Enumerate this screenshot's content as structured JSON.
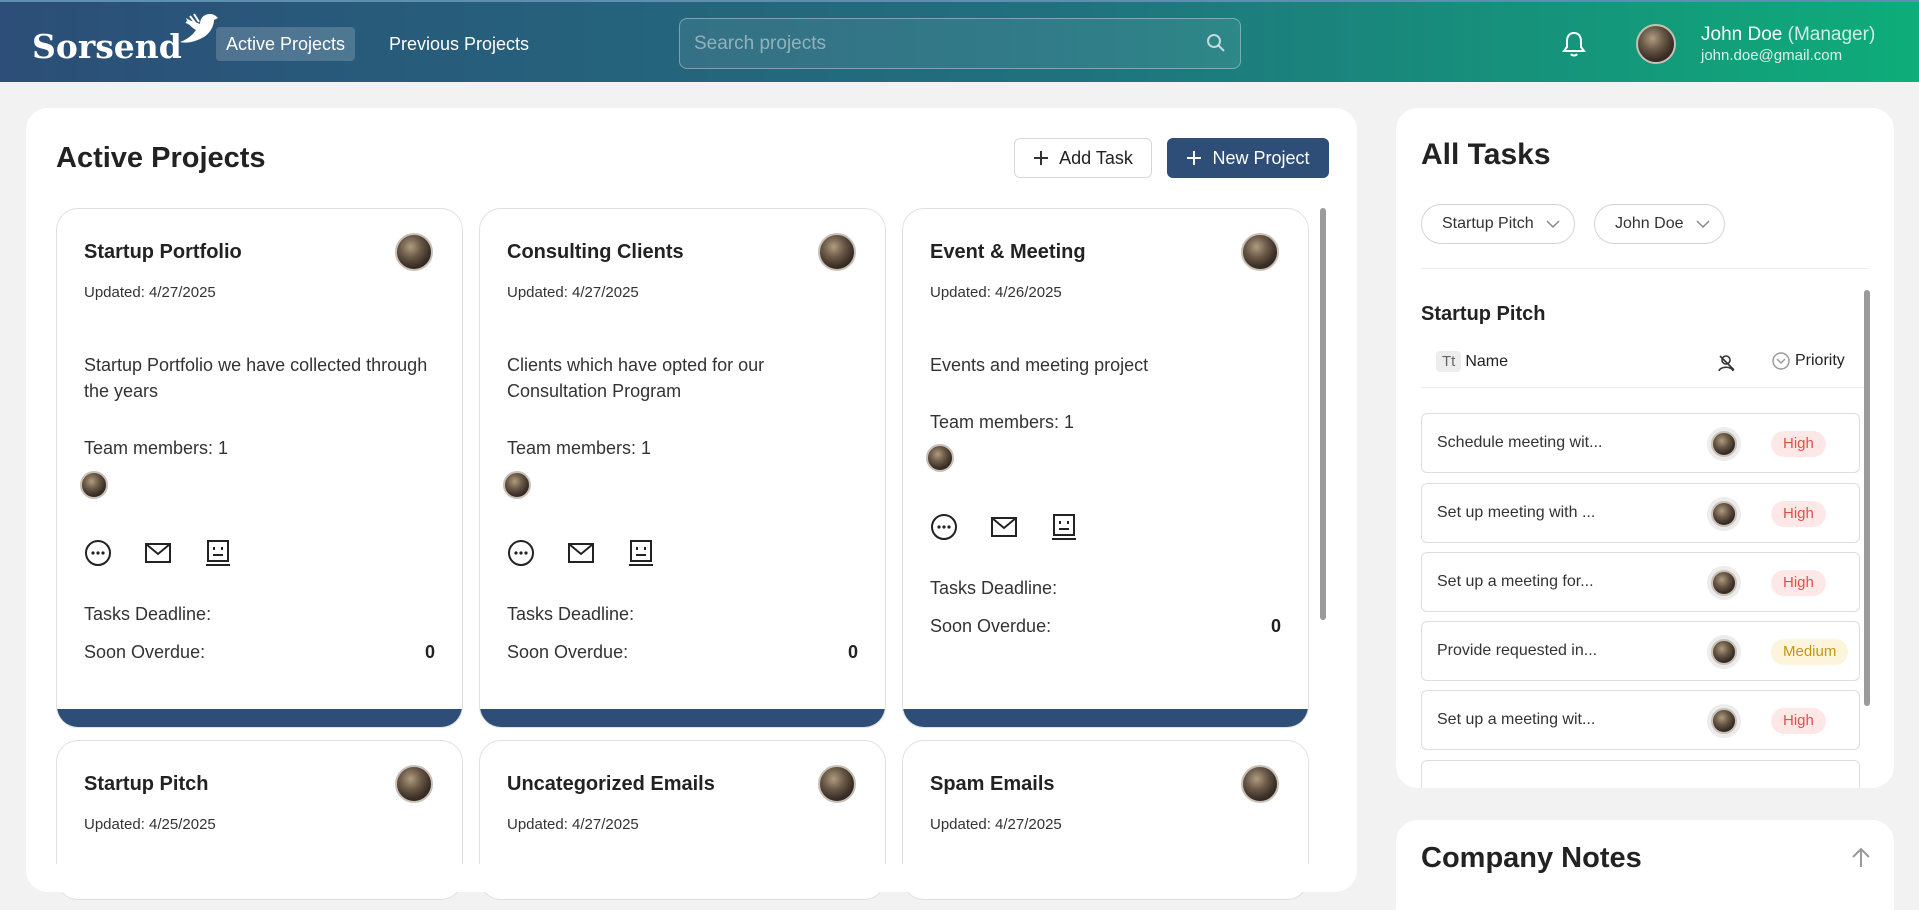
{
  "header": {
    "logo_text": "Sorsend",
    "nav": {
      "active_projects": "Active Projects",
      "previous_projects": "Previous Projects"
    },
    "search": {
      "placeholder": "Search projects",
      "value": ""
    },
    "user": {
      "name": "John Doe",
      "role": "(Manager)",
      "email": "john.doe@gmail.com"
    }
  },
  "main": {
    "title": "Active Projects",
    "add_task_label": "Add Task",
    "new_project_label": "New Project",
    "projects": [
      {
        "title": "Startup Portfolio",
        "updated": "Updated: 4/27/2025",
        "description": "Startup Portfolio we have collected through the years",
        "team": "Team members: 1",
        "deadline_label": "Tasks Deadline:",
        "overdue_label": "Soon Overdue:",
        "overdue_count": "0"
      },
      {
        "title": "Consulting Clients",
        "updated": "Updated: 4/27/2025",
        "description": "Clients which have opted for our Consultation Program",
        "team": "Team members: 1",
        "deadline_label": "Tasks Deadline:",
        "overdue_label": "Soon Overdue:",
        "overdue_count": "0"
      },
      {
        "title": "Event & Meeting",
        "updated": "Updated: 4/26/2025",
        "description": "Events and meeting project",
        "team": "Team members: 1",
        "deadline_label": "Tasks Deadline:",
        "overdue_label": "Soon Overdue:",
        "overdue_count": "0"
      },
      {
        "title": "Startup Pitch",
        "updated": "Updated: 4/25/2025"
      },
      {
        "title": "Uncategorized Emails",
        "updated": "Updated: 4/27/2025"
      },
      {
        "title": "Spam Emails",
        "updated": "Updated: 4/27/2025"
      }
    ]
  },
  "tasks_panel": {
    "title": "All Tasks",
    "filter_project": "Startup Pitch",
    "filter_user": "John Doe",
    "group_title": "Startup Pitch",
    "col_type": "Tt",
    "col_name": "Name",
    "col_priority": "Priority",
    "tasks": [
      {
        "name": "Schedule meeting wit...",
        "priority": "High"
      },
      {
        "name": "Set up meeting with ...",
        "priority": "High"
      },
      {
        "name": "Set up a meeting for...",
        "priority": "High"
      },
      {
        "name": "Provide requested in...",
        "priority": "Medium"
      },
      {
        "name": "Set up a meeting wit...",
        "priority": "High"
      }
    ]
  },
  "notes": {
    "title": "Company Notes"
  },
  "colors": {
    "primary": "#2e4e78",
    "header_start": "#2c4e78",
    "header_end": "#0ead79",
    "high": "#e0504a",
    "medium": "#c9960c"
  }
}
